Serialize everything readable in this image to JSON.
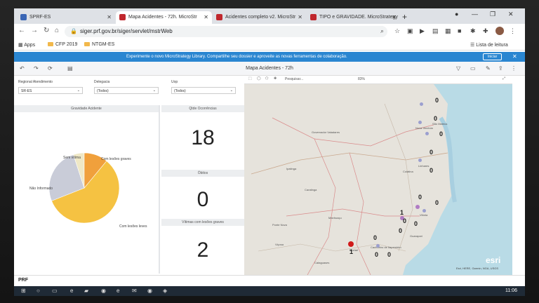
{
  "tabs": [
    {
      "title": "SPRF-ES",
      "color": "#3a66b5",
      "active": false
    },
    {
      "title": "Mapa Acidentes - 72h. MicroStr",
      "color": "#c0272d",
      "active": true
    },
    {
      "title": "Acidentes completo v2. MicroStr",
      "color": "#c0272d",
      "active": false
    },
    {
      "title": "TIPO e GRAVIDADE. MicroStrategy",
      "color": "#c0272d",
      "active": false
    }
  ],
  "address": {
    "url": "siger.prf.gov.br/siger/servlet/mstrWeb"
  },
  "bookmarks": {
    "apps": "Apps",
    "items": [
      "CFP 2019",
      "NTGM-ES"
    ],
    "reading_list": "Lista de leitura"
  },
  "banner": {
    "message": "Experimente o novo MicroStrategy Library. Compartilhe seu dossier e aproveite as novas ferramentas de colaboração.",
    "button": "Iniciar"
  },
  "toolbar": {
    "title": "Mapa Acidentes - 72h"
  },
  "filters": [
    {
      "label": "Regional Atendimento",
      "value": "SR-ES"
    },
    {
      "label": "Delegacia",
      "value": "(Todos)"
    },
    {
      "label": "Uop",
      "value": "(Todos)"
    }
  ],
  "pie": {
    "title": "Gravidade Acidente",
    "slices": [
      {
        "label": "Com lesões leves",
        "value": 58,
        "color": "#f5c242"
      },
      {
        "label": "Não Informado",
        "value": 26,
        "color": "#c9ccd8"
      },
      {
        "label": "Sem vítima",
        "value": 5,
        "color": "#efe8c6"
      },
      {
        "label": "Com lesões graves",
        "value": 11,
        "color": "#f0a03c"
      }
    ]
  },
  "kpis": [
    {
      "label": "Qtde Ocorrências",
      "value": "18"
    },
    {
      "label": "Óbitos",
      "value": "0"
    },
    {
      "label": "Vítimas com lesões graves",
      "value": "2"
    }
  ],
  "map": {
    "search_placeholder": "Pesquisar...",
    "zoom": "83%",
    "attribution": "Esri, HERE, Garmin, NGA, USGS",
    "logo": "esri",
    "cities": [
      "Governador Valadares",
      "Ipatinga",
      "Caratinga",
      "Manhuaçu",
      "Ponte Nova",
      "Viçosa",
      "Muriaé",
      "Cataguases",
      "Colatina",
      "Linhares",
      "Nova Venécia",
      "São Mateus",
      "Vitória",
      "Guarapari",
      "Cachoeiro de Itapemirim"
    ],
    "markers": [
      {
        "text": "0"
      },
      {
        "text": "0"
      },
      {
        "text": "0"
      },
      {
        "text": "0"
      },
      {
        "text": "0"
      },
      {
        "text": "0"
      },
      {
        "text": "1"
      },
      {
        "text": "0"
      },
      {
        "text": "0"
      },
      {
        "text": "0"
      },
      {
        "text": "0"
      },
      {
        "text": "1"
      },
      {
        "text": "0"
      },
      {
        "text": "0"
      },
      {
        "text": "0"
      }
    ]
  },
  "taskbar": {
    "logo": "PRF",
    "time": "11:06"
  }
}
